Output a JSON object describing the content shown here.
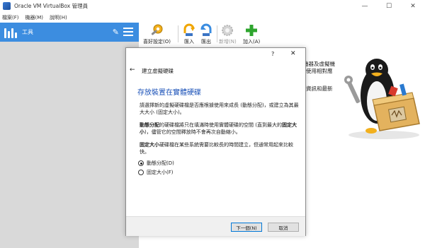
{
  "window": {
    "title": "Oracle VM VirtualBox 管理員",
    "minimize": "—",
    "maximize": "☐",
    "close": "✕"
  },
  "menubar": {
    "items": [
      "檔案(F)",
      "機器(M)",
      "說明(H)"
    ]
  },
  "sidebar": {
    "tools_label": "工具"
  },
  "toolbar": {
    "buttons": [
      {
        "label": "喜好設定(O)",
        "icon": "gear-wrench-icon",
        "enabled": true
      },
      {
        "label": "匯入",
        "icon": "import-arrow-icon",
        "enabled": true
      },
      {
        "label": "匯出",
        "icon": "export-arrow-icon",
        "enabled": true
      },
      {
        "label": "新增(N)",
        "icon": "new-gear-icon",
        "enabled": false
      },
      {
        "label": "加入(A)",
        "icon": "add-plus-icon",
        "enabled": true
      }
    ]
  },
  "background_text": [
    "機器及虛擬機",
    "使用相對應",
    "資訊和最新"
  ],
  "dialog": {
    "help": "?",
    "close": "✕",
    "back": "←",
    "title": "建立虛擬硬碟",
    "heading": "存放裝置在實體硬碟",
    "intro": "請選擇新的虛擬硬碟檔是否應根據使用來成長 (動態分配)，或建立為其最大大小 (固定大小)。",
    "dynamic_bold": "動態分配",
    "dynamic_text": "的硬碟檔將只在填滿時使用實體硬碟的空間 (直到最大的",
    "dynamic_bold2": "固定大小",
    "dynamic_text2": ")，儘管它的空間釋放時不會再次自動縮小。",
    "fixed_bold": "固定大小",
    "fixed_text": "硬碟檔在某些系統需要比較長的時間建立，但通常用起來比較快。",
    "options": [
      {
        "label": "動態分配(D)",
        "checked": true
      },
      {
        "label": "固定大小(F)",
        "checked": false
      }
    ],
    "next_button": "下一個(N)",
    "cancel_button": "取消"
  },
  "colors": {
    "accent": "#3c8de0",
    "heading": "#1b52b8",
    "panel": "#d9d9d9"
  }
}
